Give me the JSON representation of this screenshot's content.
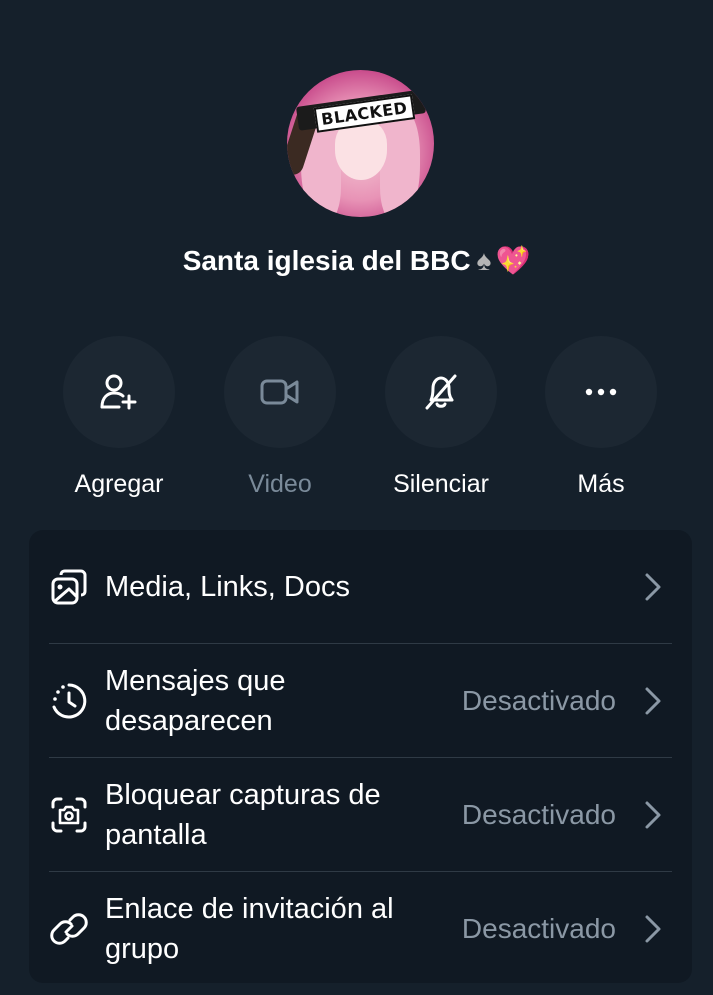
{
  "header": {
    "title": "Santa iglesia del BBC",
    "emoji_spade": "♠",
    "emoji_heart": "💖",
    "avatar_label": "BLACKED"
  },
  "actions": [
    {
      "label": "Agregar",
      "icon": "add-user-icon",
      "enabled": true
    },
    {
      "label": "Video",
      "icon": "video-camera-icon",
      "enabled": false
    },
    {
      "label": "Silenciar",
      "icon": "bell-off-icon",
      "enabled": true
    },
    {
      "label": "Más",
      "icon": "more-horizontal-icon",
      "enabled": true
    }
  ],
  "settings": {
    "rows": [
      {
        "label": "Media, Links, Docs",
        "status": "",
        "icon": "media-gallery-icon"
      },
      {
        "label": "Mensajes que desaparecen",
        "status": "Desactivado",
        "icon": "timer-icon"
      },
      {
        "label": "Bloquear capturas de pantalla",
        "status": "Desactivado",
        "icon": "screenshot-camera-icon"
      },
      {
        "label": "Enlace de invitación al grupo",
        "status": "Desactivado",
        "icon": "link-icon"
      }
    ]
  },
  "colors": {
    "background": "#15202b",
    "card": "#101923",
    "action_circle": "#1c2732",
    "text_primary": "#ffffff",
    "text_secondary": "#8b98a5",
    "text_disabled": "#7a8a99"
  }
}
